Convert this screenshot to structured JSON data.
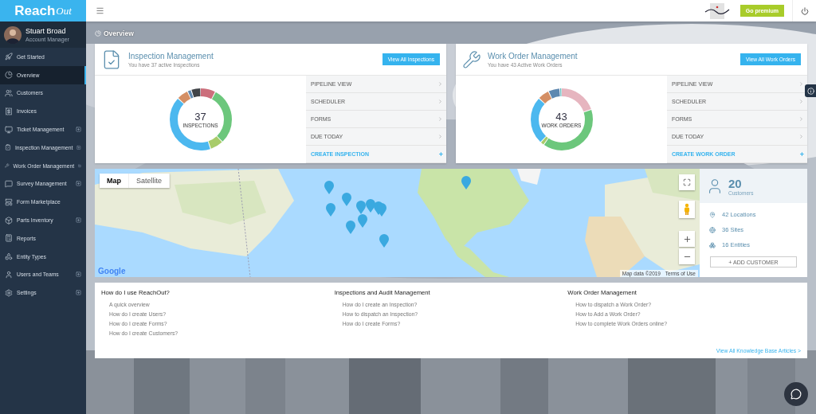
{
  "brand": {
    "name": "Reach",
    "suffix": "Out"
  },
  "user": {
    "name": "Stuart Broad",
    "role": "Account Manager"
  },
  "sidebar": {
    "items": [
      {
        "label": "Get Started",
        "selected": false,
        "expandable": false
      },
      {
        "label": "Overview",
        "selected": true,
        "expandable": false
      },
      {
        "label": "Customers",
        "selected": false,
        "expandable": false
      },
      {
        "label": "Invoices",
        "selected": false,
        "expandable": false
      },
      {
        "label": "Ticket Management",
        "selected": false,
        "expandable": true
      },
      {
        "label": "Inspection Management",
        "selected": false,
        "expandable": true
      },
      {
        "label": "Work Order Management",
        "selected": false,
        "expandable": true
      },
      {
        "label": "Survey Management",
        "selected": false,
        "expandable": true
      },
      {
        "label": "Form Marketplace",
        "selected": false,
        "expandable": false
      },
      {
        "label": "Parts Inventory",
        "selected": false,
        "expandable": true
      },
      {
        "label": "Reports",
        "selected": false,
        "expandable": false
      },
      {
        "label": "Entity Types",
        "selected": false,
        "expandable": false
      },
      {
        "label": "Users and Teams",
        "selected": false,
        "expandable": true
      },
      {
        "label": "Settings",
        "selected": false,
        "expandable": true
      }
    ]
  },
  "header": {
    "premium_button": "Go premium"
  },
  "page_title": "Overview",
  "cards": [
    {
      "title": "Inspection Management",
      "subtitle": "You have 37 active Inspections",
      "button": "View All Inspections",
      "count": "37",
      "count_label": "INSPECTIONS",
      "links": [
        "PIPELINE VIEW",
        "SCHEDULER",
        "FORMS",
        "DUE TODAY"
      ],
      "create": "CREATE INSPECTION",
      "create_mark": "+"
    },
    {
      "title": "Work Order Management",
      "subtitle": "You have 43 Active Work Orders",
      "button": "View All Work Orders",
      "count": "43",
      "count_label": "WORK ORDERS",
      "links": [
        "PIPELINE VIEW",
        "SCHEDULER",
        "FORMS",
        "DUE TODAY"
      ],
      "create": "CREATE WORK ORDER",
      "create_mark": "+"
    }
  ],
  "map": {
    "tabs": [
      {
        "label": "Map",
        "selected": true
      },
      {
        "label": "Satellite",
        "selected": false
      }
    ],
    "attribution": "Google",
    "map_data": "Map data ©2019",
    "terms": "Terms of Use"
  },
  "stats": {
    "count": "20",
    "count_label": "Customers",
    "items": [
      "42 Locations",
      "36 Sites",
      "16 Entities"
    ],
    "button": "+ ADD CUSTOMER"
  },
  "help": {
    "columns": [
      {
        "title": "How do I use ReachOut?",
        "links": [
          "A quick overview",
          "How do I create Users?",
          "How do I create Forms?",
          "How do I create Customers?"
        ]
      },
      {
        "title": "Inspections and Audit Management",
        "links": [
          "How do I create an Inspection?",
          "How to dispatch an Inspection?",
          "How do I create Forms?"
        ]
      },
      {
        "title": "Work Order Management",
        "links": [
          "How to dispatch a Work Order?",
          "How to Add a Work Order?",
          "How to complete Work Orders online?"
        ]
      }
    ],
    "footer_link": "View All Knowledge Base Articles >"
  }
}
